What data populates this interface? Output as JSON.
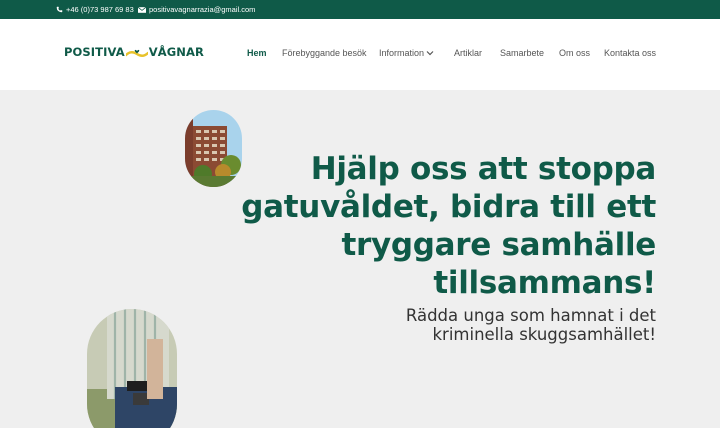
{
  "topbar": {
    "phone": "+46 (0)73 987 69 83",
    "email": "positivavagnarrazia@gmail.com",
    "phone_icon": "phone-icon",
    "email_icon": "mail-icon",
    "background": "#0f5a48"
  },
  "logo": {
    "part1": "POSITIVA",
    "part2": "VÅGNAR"
  },
  "nav": {
    "items": [
      {
        "label": "Hem",
        "active": true
      },
      {
        "label": "Förebyggande besök"
      },
      {
        "label": "Information",
        "dropdown": true
      },
      {
        "label": "Artiklar"
      },
      {
        "label": "Samarbete"
      },
      {
        "label": "Om oss"
      },
      {
        "label": "Kontakta oss"
      }
    ]
  },
  "hero": {
    "headline": [
      "Hjälp oss att stoppa",
      "gatuvåldet, bidra till ett",
      "tryggare samhälle",
      "tillsammans!"
    ],
    "subtitle": [
      "Rädda unga som hamnat i det",
      "kriminella skuggsamhället!"
    ]
  },
  "colors": {
    "brand": "#0f5a48",
    "accent": "#e8c22b",
    "hero_bg": "#efefef"
  }
}
